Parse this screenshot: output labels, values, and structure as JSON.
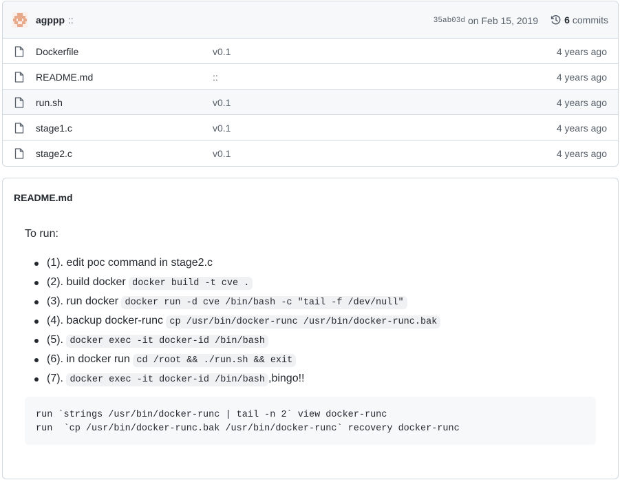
{
  "commit": {
    "author": "agppp",
    "message": "::",
    "sha": "35ab03d",
    "date": "on Feb 15, 2019",
    "count": "6",
    "count_label": "commits"
  },
  "files": [
    {
      "name": "Dockerfile",
      "message": "v0.1",
      "age": "4 years ago"
    },
    {
      "name": "README.md",
      "message": "::",
      "age": "4 years ago"
    },
    {
      "name": "run.sh",
      "message": "v0.1",
      "age": "4 years ago"
    },
    {
      "name": "stage1.c",
      "message": "v0.1",
      "age": "4 years ago"
    },
    {
      "name": "stage2.c",
      "message": "v0.1",
      "age": "4 years ago"
    }
  ],
  "readme": {
    "title": "README.md",
    "intro": "To run:",
    "steps": [
      {
        "text": "(1). edit poc command in stage2.c",
        "code": "",
        "suffix": ""
      },
      {
        "text": "(2). build docker ",
        "code": "docker build -t cve .",
        "suffix": ""
      },
      {
        "text": "(3). run docker ",
        "code": "docker run -d cve /bin/bash -c \"tail -f /dev/null\"",
        "suffix": ""
      },
      {
        "text": "(4). backup docker-runc ",
        "code": "cp /usr/bin/docker-runc /usr/bin/docker-runc.bak",
        "suffix": ""
      },
      {
        "text": "(5). ",
        "code": "docker exec -it docker-id /bin/bash",
        "suffix": ""
      },
      {
        "text": "(6). in docker run ",
        "code": "cd /root && ./run.sh && exit",
        "suffix": ""
      },
      {
        "text": "(7). ",
        "code": "docker exec -it docker-id /bin/bash",
        "suffix": ",bingo!!"
      }
    ],
    "code_block": [
      "run `strings /usr/bin/docker-runc | tail -n 2` view docker-runc",
      "run  `cp /usr/bin/docker-runc.bak /usr/bin/docker-runc` recovery docker-runc"
    ]
  },
  "colors": {
    "border": "#d0d7de",
    "header_bg": "#f6f8fa",
    "avatar": "#e8a98a",
    "muted_text": "#57606a"
  },
  "icons": {
    "avatar": "identicon-avatar",
    "file": "file-icon",
    "history": "history-icon"
  }
}
